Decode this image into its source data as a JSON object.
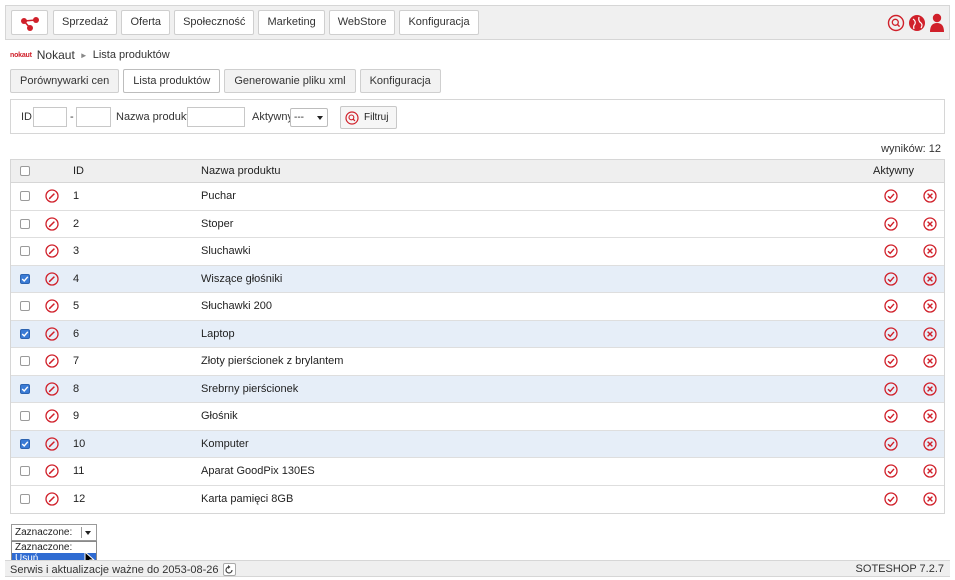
{
  "header": {
    "nav": [
      "Sprzedaż",
      "Oferta",
      "Społeczność",
      "Marketing",
      "WebStore",
      "Konfiguracja"
    ],
    "icons": [
      "search-icon",
      "globe-icon",
      "user-icon"
    ],
    "accent": "#d0202a"
  },
  "breadcrumb": {
    "brand": "nokaut",
    "module": "Nokaut",
    "separator": "►",
    "page": "Lista produktów"
  },
  "tabs": [
    "Porównywarki cen",
    "Lista produktów",
    "Generowanie pliku xml",
    "Konfiguracja"
  ],
  "active_tab": "Lista produktów",
  "filter": {
    "id_label": "ID",
    "id_dash": "-",
    "id_from": "",
    "id_to": "",
    "name_label": "Nazwa produktu",
    "name_value": "",
    "active_label": "Aktywny",
    "active_value": "---",
    "button": "Filtruj"
  },
  "results_label": "wyników: 12",
  "table": {
    "columns": {
      "id": "ID",
      "name": "Nazwa produktu",
      "active": "Aktywny"
    },
    "rows": [
      {
        "id": "1",
        "name": "Puchar",
        "checked": false
      },
      {
        "id": "2",
        "name": "Stoper",
        "checked": false
      },
      {
        "id": "3",
        "name": "Sluchawki",
        "checked": false
      },
      {
        "id": "4",
        "name": "Wiszące głośniki",
        "checked": true
      },
      {
        "id": "5",
        "name": "Słuchawki 200",
        "checked": false
      },
      {
        "id": "6",
        "name": "Laptop",
        "checked": true
      },
      {
        "id": "7",
        "name": "Złoty pierścionek z brylantem",
        "checked": false
      },
      {
        "id": "8",
        "name": "Srebrny pierścionek",
        "checked": true
      },
      {
        "id": "9",
        "name": "Głośnik",
        "checked": false
      },
      {
        "id": "10",
        "name": "Komputer",
        "checked": true
      },
      {
        "id": "11",
        "name": "Aparat GoodPix 130ES",
        "checked": false
      },
      {
        "id": "12",
        "name": "Karta pamięci 8GB",
        "checked": false
      }
    ]
  },
  "bulk": {
    "selected": "Zaznaczone:",
    "options": [
      "Zaznaczone:",
      "Usuń"
    ],
    "highlighted": "Usuń"
  },
  "footer": {
    "service": "Serwis i aktualizacje ważne do 2053-08-26",
    "version": "SOTESHOP 7.2.7"
  },
  "colors": {
    "icon_red": "#d0202a",
    "selected_row": "#e6eef8",
    "checkbox_on": "#3a7bd5"
  }
}
